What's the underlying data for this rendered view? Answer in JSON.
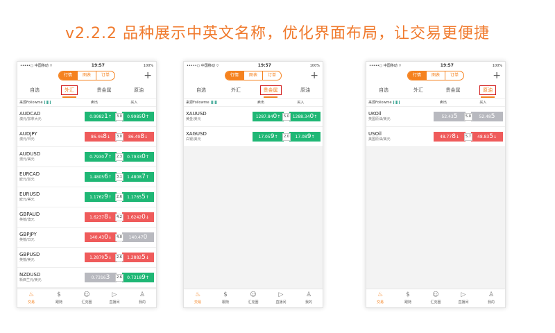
{
  "headline": "v2.2.2  品种展示中英文名称，优化界面布局，让交易更便捷",
  "status": {
    "carrier": "•••••○ 中国移动",
    "wifi": "⌔",
    "time": "19:57",
    "battery": "100%"
  },
  "nav": {
    "segments": [
      "行情",
      "图表",
      "订单"
    ],
    "plus": "+"
  },
  "colheader": {
    "source": "来源Followme",
    "sell": "卖出",
    "buy": "买入"
  },
  "bottom_tabs": [
    {
      "icon": "♨",
      "label": "交易"
    },
    {
      "icon": "$",
      "label": "跟随"
    },
    {
      "icon": "☺",
      "label": "汇克圈"
    },
    {
      "icon": "▷",
      "label": "直播间"
    },
    {
      "icon": "♙",
      "label": "我的"
    }
  ],
  "phones": [
    {
      "tabs": [
        "自选",
        "外汇",
        "贵金属",
        "原油"
      ],
      "active_tab": 1,
      "rows": [
        {
          "code": "AUDCAD",
          "cn": "澳元/加拿大元",
          "sell": "0.9982",
          "sell_big": "1",
          "sell_sup": "↑",
          "spread": "3.0",
          "buy": "0.9985",
          "buy_big": "0",
          "buy_sup": "↑",
          "sc": "g",
          "bc": "g"
        },
        {
          "code": "AUDJPY",
          "cn": "澳元/日元",
          "sell": "86.46",
          "sell_big": "8",
          "sell_sup": "↓",
          "spread": "3.0",
          "buy": "86.49",
          "buy_big": "8",
          "buy_sup": "↓",
          "sc": "r",
          "bc": "r"
        },
        {
          "code": "AUDUSD",
          "cn": "澳元/美元",
          "sell": "0.7930",
          "sell_big": "7",
          "sell_sup": "↑",
          "spread": "2.3",
          "buy": "0.7933",
          "buy_big": "0",
          "buy_sup": "↑",
          "sc": "g",
          "bc": "g"
        },
        {
          "code": "EURCAD",
          "cn": "欧元/加元",
          "sell": "1.4805",
          "sell_big": "6",
          "sell_sup": "↑",
          "spread": "3.1",
          "buy": "1.4808",
          "buy_big": "7",
          "buy_sup": "↑",
          "sc": "g",
          "bc": "g"
        },
        {
          "code": "EURUSD",
          "cn": "欧元/美元",
          "sell": "1.1762",
          "sell_big": "9",
          "sell_sup": "↑",
          "spread": "2.6",
          "buy": "1.1765",
          "buy_big": "5",
          "buy_sup": "↑",
          "sc": "g",
          "bc": "g"
        },
        {
          "code": "GBPAUD",
          "cn": "英镑/澳元",
          "sell": "1.6237",
          "sell_big": "8",
          "sell_sup": "↓",
          "spread": "4.2",
          "buy": "1.6242",
          "buy_big": "0",
          "buy_sup": "↓",
          "sc": "r",
          "bc": "r"
        },
        {
          "code": "GBPJPY",
          "cn": "英镑/日元",
          "sell": "140.43",
          "sell_big": "0",
          "sell_sup": "↓",
          "spread": "4.0",
          "buy": "140.47",
          "buy_big": "0",
          "buy_sup": "",
          "sc": "r",
          "bc": "gr"
        },
        {
          "code": "GBPUSD",
          "cn": "英镑/美元",
          "sell": "1.2879",
          "sell_big": "5",
          "sell_sup": "↓",
          "spread": "2.6",
          "buy": "1.2882",
          "buy_big": "5",
          "buy_sup": "↓",
          "sc": "r",
          "bc": "r"
        },
        {
          "code": "NZDUSD",
          "cn": "新西兰元/美元",
          "sell": "0.7316",
          "sell_big": "3",
          "sell_sup": "",
          "spread": "2.6",
          "buy": "0.7318",
          "buy_big": "9",
          "buy_sup": "↑",
          "sc": "gr",
          "bc": "g"
        }
      ]
    },
    {
      "tabs": [
        "自选",
        "外汇",
        "贵金属",
        "原油"
      ],
      "active_tab": 2,
      "rows": [
        {
          "code": "XAUUSD",
          "cn": "黄金/美元",
          "sell": "1287.84",
          "sell_big": "0",
          "sell_sup": "↑",
          "spread": "5.0",
          "buy": "1288.34",
          "buy_big": "0",
          "buy_sup": "↑",
          "sc": "g",
          "bc": "g"
        },
        {
          "code": "XAGUSD",
          "cn": "白银/美元",
          "sell": "17.05",
          "sell_big": "9",
          "sell_sup": "↑",
          "spread": "2.0",
          "buy": "17.08",
          "buy_big": "9",
          "buy_sup": "↑",
          "sc": "g",
          "bc": "g"
        }
      ]
    },
    {
      "tabs": [
        "自选",
        "外汇",
        "贵金属",
        "原油"
      ],
      "active_tab": 3,
      "rows": [
        {
          "code": "UKOil",
          "cn": "英国原油/美元",
          "sell": "52.43",
          "sell_big": "5",
          "sell_sup": "",
          "spread": "5.0",
          "buy": "52.48",
          "buy_big": "5",
          "buy_sup": "",
          "sc": "gr",
          "bc": "gr"
        },
        {
          "code": "USOil",
          "cn": "美国原油/美元",
          "sell": "48.77",
          "sell_big": "8",
          "sell_sup": "↓",
          "spread": "5.7",
          "buy": "48.83",
          "buy_big": "5",
          "buy_sup": "↓",
          "sc": "r",
          "bc": "r"
        }
      ]
    }
  ]
}
